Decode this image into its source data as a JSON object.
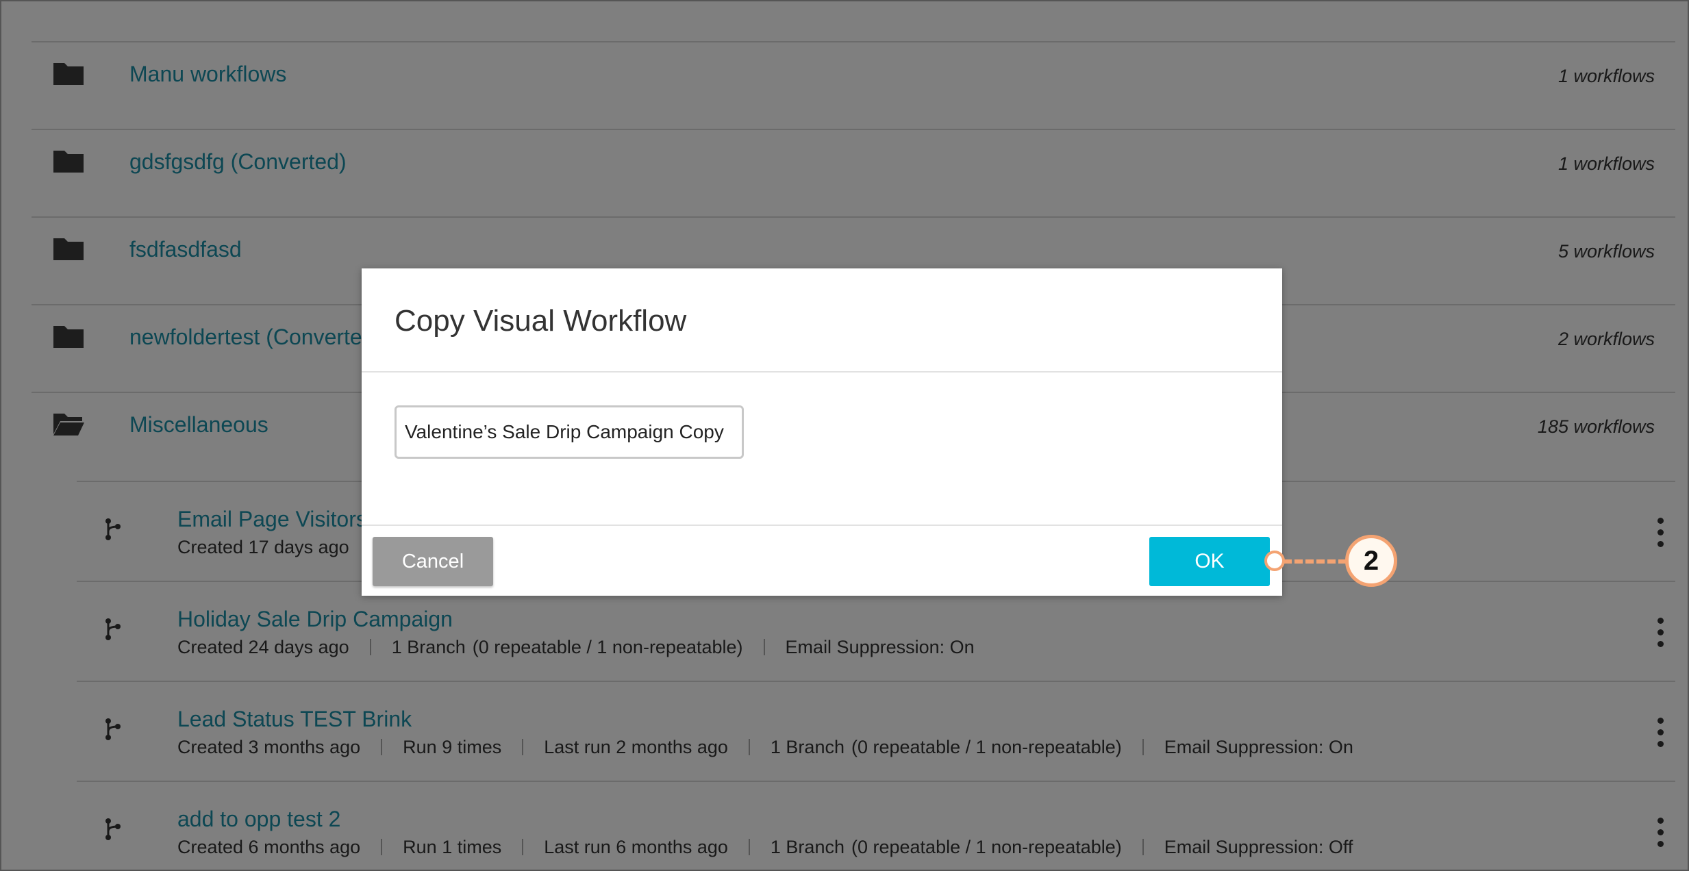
{
  "folders": [
    {
      "name": "Manu workflows",
      "count": "1 workflows",
      "icon": "folder-icon"
    },
    {
      "name": "gdsfgsdfg (Converted)",
      "count": "1 workflows",
      "icon": "folder-icon"
    },
    {
      "name": "fsdfasdfasd",
      "count": "5 workflows",
      "icon": "folder-icon"
    },
    {
      "name": "newfoldertest (Converted)",
      "count": "2 workflows",
      "icon": "folder-icon"
    },
    {
      "name": "Miscellaneous",
      "count": "185 workflows",
      "icon": "folder-open-icon"
    }
  ],
  "workflows": [
    {
      "name": "Email Page Visitors",
      "created": "Created 17 days ago"
    },
    {
      "name": "Holiday Sale Drip Campaign",
      "created": "Created 24 days ago",
      "branch": "1 Branch",
      "repeat": "(0 repeatable / 1 non-repeatable)",
      "suppression": "Email Suppression: On"
    },
    {
      "name": "Lead Status TEST Brink",
      "created": "Created 3 months ago",
      "runs": "Run 9 times",
      "last_run": "Last run 2 months ago",
      "branch": "1 Branch",
      "repeat": "(0 repeatable / 1 non-repeatable)",
      "suppression": "Email Suppression: On"
    },
    {
      "name": "add to opp test 2",
      "created": "Created 6 months ago",
      "runs": "Run 1 times",
      "last_run": "Last run 6 months ago",
      "branch": "1 Branch",
      "repeat": "(0 repeatable / 1 non-repeatable)",
      "suppression": "Email Suppression: Off"
    }
  ],
  "dialog": {
    "title": "Copy Visual Workflow",
    "name_value": "Valentine’s Sale Drip Campaign Copy",
    "cancel_label": "Cancel",
    "ok_label": "OK"
  },
  "callout": {
    "number": "2",
    "color": "#f4a372"
  },
  "colors": {
    "link": "#1b8fa6",
    "ok_button": "#00b9d8",
    "cancel_button": "#9a9a9a"
  }
}
